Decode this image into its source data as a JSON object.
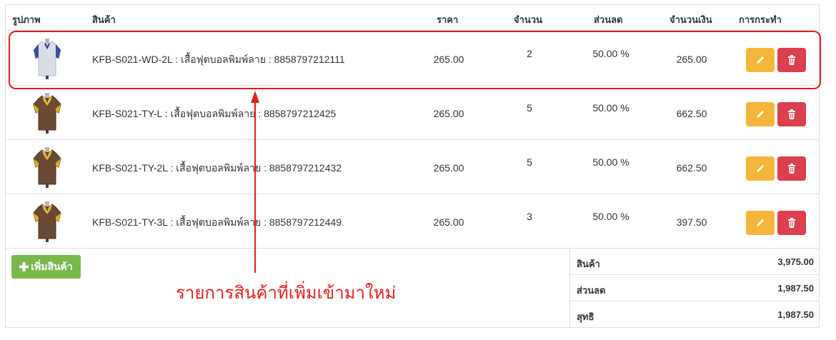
{
  "table": {
    "headers": {
      "image": "รูปภาพ",
      "product": "สินค้า",
      "price": "ราคา",
      "quantity": "จำนวน",
      "discount": "ส่วนลด",
      "amount": "จำนวนเงิน",
      "actions": "การกระทำ"
    },
    "rows": [
      {
        "name": "KFB-S021-WD-2L : เสื้อฟุตบอลพิมพ์ลาย : 8858797212111",
        "price": "265.00",
        "qty": "2",
        "discount": "50.00 %",
        "amount": "265.00",
        "shirt_color": "white"
      },
      {
        "name": "KFB-S021-TY-L : เสื้อฟุตบอลพิมพ์ลาย : 8858797212425",
        "price": "265.00",
        "qty": "5",
        "discount": "50.00 %",
        "amount": "662.50",
        "shirt_color": "brown-yellow"
      },
      {
        "name": "KFB-S021-TY-2L : เสื้อฟุตบอลพิมพ์ลาย : 8858797212432",
        "price": "265.00",
        "qty": "5",
        "discount": "50.00 %",
        "amount": "662.50",
        "shirt_color": "brown-yellow"
      },
      {
        "name": "KFB-S021-TY-3L : เสื้อฟุตบอลพิมพ์ลาย : 8858797212449",
        "price": "265.00",
        "qty": "3",
        "discount": "50.00 %",
        "amount": "397.50",
        "shirt_color": "brown-yellow"
      }
    ]
  },
  "actions": {
    "edit_icon": "pencil-icon",
    "delete_icon": "trash-icon",
    "add_product_label": "เพิ่มสินค้า"
  },
  "summary": {
    "product_label": "สินค้า",
    "product_value": "3,975.00",
    "discount_label": "ส่วนลด",
    "discount_value": "1,987.50",
    "net_label": "สุทธิ",
    "net_value": "1,987.50"
  },
  "annotation": {
    "text": "รายการสินค้าที่เพิ่มเข้ามาใหม่"
  },
  "colors": {
    "edit_button": "#f4b63a",
    "delete_button": "#dc3f4d",
    "add_button": "#79b94a",
    "annotation": "#e21d1d"
  }
}
